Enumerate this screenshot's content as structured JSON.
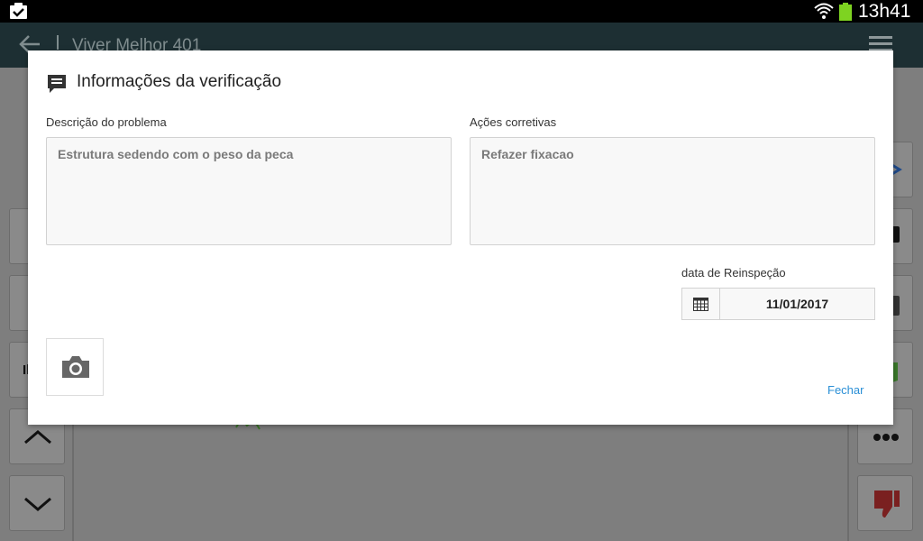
{
  "status_bar": {
    "time": "13h41"
  },
  "app_bar": {
    "title": "Viver Melhor 401"
  },
  "background": {
    "partial_text": "Il"
  },
  "dialog": {
    "title": "Informações da verificação",
    "problem_label": "Descrição do problema",
    "problem_value": "Estrutura sedendo com o peso da peca",
    "actions_label": "Ações corretivas",
    "actions_value": "Refazer fixacao",
    "reinspection_label": "data de Reinspeção",
    "reinspection_date": "11/01/2017",
    "close_label": "Fechar"
  },
  "colors": {
    "link": "#2a8fd6",
    "appbar": "#1d2f33",
    "battery": "#7ed321"
  }
}
